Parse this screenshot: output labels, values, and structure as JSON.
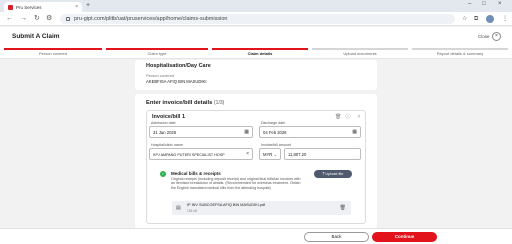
{
  "browser": {
    "tab_title": "Pru Services",
    "url": "pru-gipt.com/plitb/uat/pruservices/app/home/claims-submission"
  },
  "app": {
    "title": "Submit A Claim",
    "close_label": "Close"
  },
  "stepper": {
    "steps": [
      {
        "label": "Person covered",
        "state": "done"
      },
      {
        "label": "Claim type",
        "state": "done"
      },
      {
        "label": "Claim details",
        "state": "active"
      },
      {
        "label": "Upload documents",
        "state": "pending"
      },
      {
        "label": "Payout details & summary",
        "state": "pending"
      }
    ],
    "colors": {
      "done": "#e3131b",
      "pending": "#d6d6d6"
    }
  },
  "hospitalisation": {
    "heading": "Hospitalisation/Day Care",
    "person_label": "Person covered",
    "person_value": "AKEBFISA AFIQ BIN MASUDIKI"
  },
  "invoice_section": {
    "heading": "Enter invoice/bill details",
    "count": "(1/3)",
    "invoice": {
      "title": "Invoice/bill 1",
      "admission_label": "Admission date",
      "admission_value": "31 Jan 2026",
      "discharge_label": "Discharge date",
      "discharge_value": "04 Feb 2026",
      "hospital_label": "Hospital/clinic name",
      "hospital_value": "KPJ AMPANG PUTERI SPECIALIST HOSP",
      "amount_label": "Invoice/bill amount",
      "currency_value": "MYR",
      "amount_value": "11,807.20",
      "medical_title": "Medical bills & receipts",
      "medical_desc": "Original receipts (including deposit receipt) and original final bills/tax invoices with an itemised breakdown of details. (Recommended for overseas treatment. Obtain the English translated medical bills from the attending hospital)",
      "upload_label": "Upload file",
      "file_name": "IP INV SUBCOEFSA AFIQ BIN MASUDIKI.pdf",
      "file_size": "155 kB"
    }
  },
  "footer": {
    "back_label": "Back",
    "continue_label": "Continue"
  }
}
